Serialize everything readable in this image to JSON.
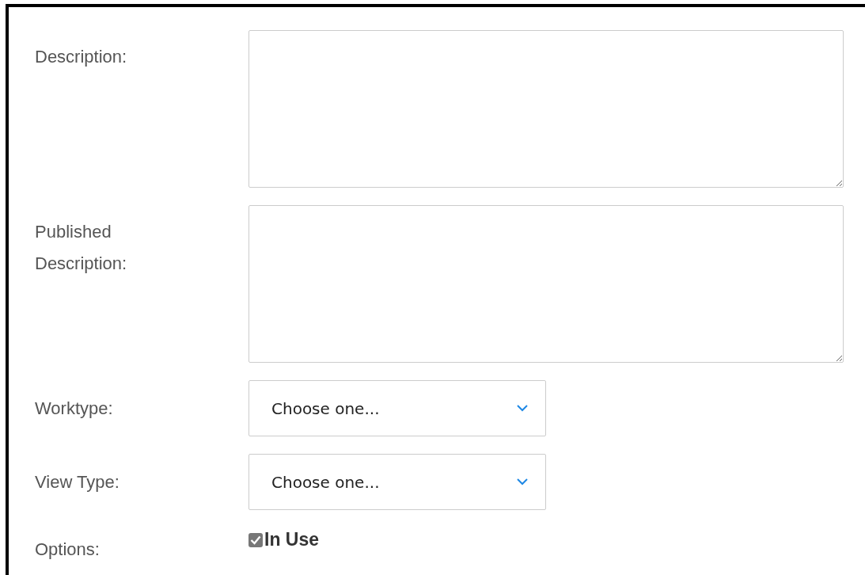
{
  "fields": [
    {
      "kind": "textarea",
      "label": "Description:"
    },
    {
      "kind": "textarea",
      "label": "Published Description:"
    },
    {
      "kind": "select",
      "label": "Worktype:",
      "value": "Choose one..."
    },
    {
      "kind": "select",
      "label": "View Type:",
      "value": "Choose one..."
    },
    {
      "kind": "checkbox",
      "label": "Options:",
      "option": "In Use",
      "checked": true,
      "disabled": true
    }
  ]
}
